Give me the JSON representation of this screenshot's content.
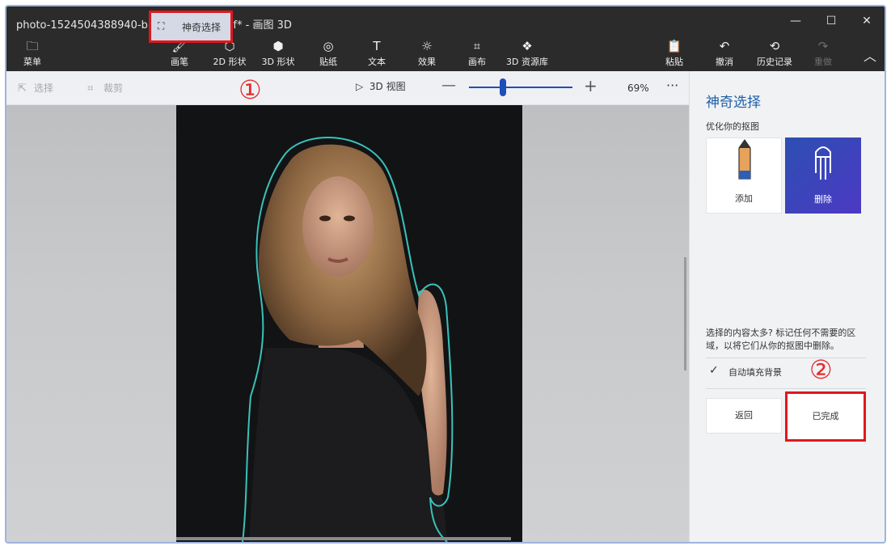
{
  "window": {
    "title": "photo-1524504388940-b1c1722653e1.jfif* - 画图 3D",
    "controls": {
      "minimize": "—",
      "maximize": "☐",
      "close": "✕"
    }
  },
  "ribbon": {
    "menu": {
      "label": "菜单",
      "icon": "folder-icon"
    },
    "items": [
      {
        "label": "画笔",
        "icon": "brush-icon"
      },
      {
        "label": "2D 形状",
        "icon": "shapes-2d-icon"
      },
      {
        "label": "3D 形状",
        "icon": "cube-icon"
      },
      {
        "label": "贴纸",
        "icon": "sticker-icon"
      },
      {
        "label": "文本",
        "icon": "text-icon"
      },
      {
        "label": "效果",
        "icon": "effects-icon"
      },
      {
        "label": "画布",
        "icon": "canvas-icon"
      },
      {
        "label": "3D 资源库",
        "icon": "library-icon"
      }
    ],
    "right_items": [
      {
        "label": "粘贴",
        "icon": "paste-icon"
      },
      {
        "label": "撤消",
        "icon": "undo-icon"
      },
      {
        "label": "历史记录",
        "icon": "history-icon"
      },
      {
        "label": "重做",
        "icon": "redo-icon",
        "disabled": true
      }
    ],
    "collapse_icon": "chevron-up-icon"
  },
  "toolbar": {
    "select": "选择",
    "crop": "裁剪",
    "magic_select": "神奇选择",
    "view_3d": "3D 视图",
    "zoom_percent": "69%",
    "zoom_level": 0.3,
    "more": "···"
  },
  "annotations": {
    "marker1": "①",
    "marker2": "②"
  },
  "panel": {
    "title": "神奇选择",
    "subtitle": "优化你的抠图",
    "tool_add": "添加",
    "tool_remove": "删除",
    "description": "选择的内容太多? 标记任何不需要的区域，以将它们从你的抠图中删除。",
    "autofill_label": "自动填充背景",
    "autofill_checked": true,
    "back_button": "返回",
    "done_button": "已完成"
  },
  "colors": {
    "accent": "#1e5fa8",
    "highlight_box": "#e0181c",
    "selection_outline": "#39c3b9"
  }
}
